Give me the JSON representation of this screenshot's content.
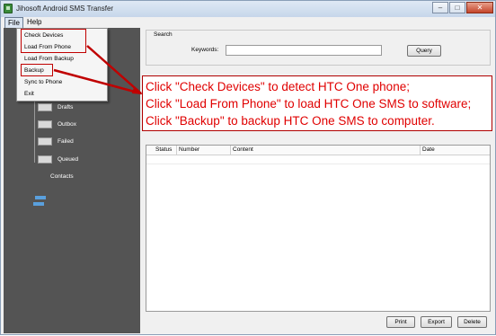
{
  "window": {
    "title": "Jihosoft Android SMS Transfer",
    "minimize_glyph": "–",
    "maximize_glyph": "□",
    "close_glyph": "✕"
  },
  "menubar": {
    "file": "File",
    "help": "Help"
  },
  "file_menu": {
    "items": [
      "Check Devices",
      "Load From Phone",
      "Load From Backup",
      "Backup",
      "Sync to Phone",
      "Exit"
    ]
  },
  "sidebar": {
    "items": [
      "Drafts",
      "Outbox",
      "Failed",
      "Queued",
      "Contacts"
    ]
  },
  "search": {
    "group_label": "Search",
    "keywords_label": "Keywords:",
    "keywords_value": "",
    "query_button": "Query"
  },
  "table": {
    "columns": [
      "Status",
      "Number",
      "Content",
      "Date"
    ]
  },
  "buttons": {
    "print": "Print",
    "export": "Export",
    "delete": "Delete"
  },
  "callout": {
    "lines": [
      "Click \"Check Devices\" to detect HTC One phone;",
      "Click \"Load From Phone\" to load HTC One SMS to software;",
      "Click \"Backup\" to backup HTC One SMS to computer."
    ]
  },
  "colors": {
    "annotation_red": "#c00000",
    "sidebar_bg": "#545454",
    "callout_text": "#e00000"
  }
}
